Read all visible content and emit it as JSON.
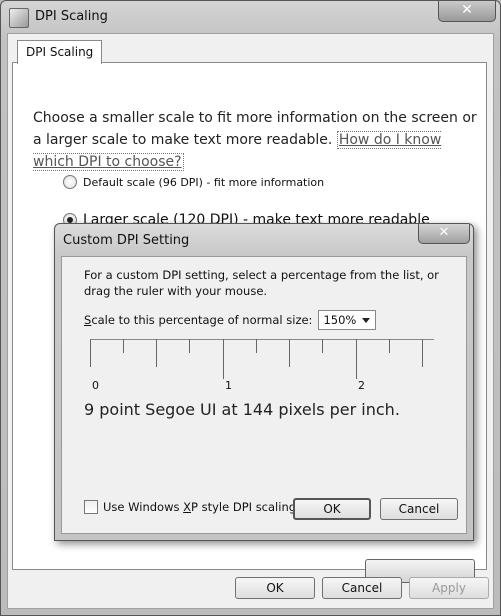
{
  "window": {
    "title": "DPI Scaling",
    "close_glyph": "✕",
    "icon": "display-settings-icon"
  },
  "tab": {
    "label": "DPI Scaling"
  },
  "intro": {
    "text": "Choose a smaller scale to fit more information on the screen or a larger scale to make text more readable.",
    "link": "How do I know which DPI to choose?"
  },
  "options": [
    {
      "label": "Default scale (96 DPI) - fit more information",
      "checked": false
    },
    {
      "label": "Larger scale (120 DPI) - make text more readable",
      "checked": true
    }
  ],
  "buttons": {
    "ok": "OK",
    "cancel": "Cancel",
    "apply": "Apply"
  },
  "dialog": {
    "title": "Custom DPI Setting",
    "close_glyph": "✕",
    "description": "For a custom DPI setting, select a percentage from the list, or drag the ruler with your mouse.",
    "scale_label_prefix": "S",
    "scale_label_rest": "cale to this percentage of normal size:",
    "scale_value": "150%",
    "ruler_labels": [
      "0",
      "1",
      "2"
    ],
    "sample_text": "9 point Segoe UI at 144 pixels per inch.",
    "checkbox_label_a": "Use Windows ",
    "checkbox_label_u": "X",
    "checkbox_label_b": "P style DPI scaling",
    "checkbox_checked": false,
    "ok": "OK",
    "cancel": "Cancel"
  }
}
